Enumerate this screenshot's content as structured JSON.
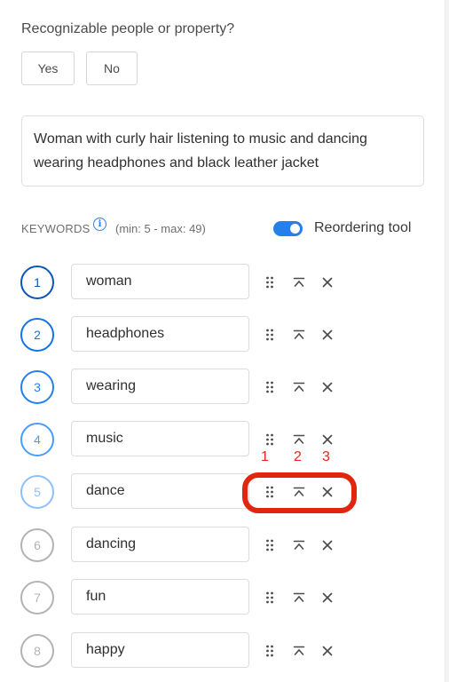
{
  "recognizable": {
    "question": "Recognizable people or property?",
    "yes_label": "Yes",
    "no_label": "No"
  },
  "title_text": "Woman with curly hair listening to music and dancing wearing headphones and black leather jacket",
  "keywords_header": {
    "label": "KEYWORDS",
    "info_icon": "info-icon",
    "range": "(min: 5 - max: 49)",
    "toggle_label": "Reordering tool",
    "toggle_on": true
  },
  "keywords": [
    {
      "index": "1",
      "value": "woman",
      "color": "#0d55b4"
    },
    {
      "index": "2",
      "value": "headphones",
      "color": "#1473e6"
    },
    {
      "index": "3",
      "value": "wearing",
      "color": "#2680eb"
    },
    {
      "index": "4",
      "value": "music",
      "color": "#4b9cf5"
    },
    {
      "index": "5",
      "value": "dance",
      "color": "#8ec0f8"
    },
    {
      "index": "6",
      "value": "dancing",
      "color": "#b3b3b3"
    },
    {
      "index": "7",
      "value": "fun",
      "color": "#b3b3b3"
    },
    {
      "index": "8",
      "value": "happy",
      "color": "#b3b3b3"
    }
  ],
  "row_icons": [
    "drag-handle-icon",
    "move-to-top-icon",
    "remove-icon"
  ],
  "annotations": {
    "labels": [
      "1",
      "2",
      "3"
    ],
    "color": "#e0260f"
  },
  "colors": {
    "accent": "#2680eb",
    "icon": "#4b4b4b"
  }
}
